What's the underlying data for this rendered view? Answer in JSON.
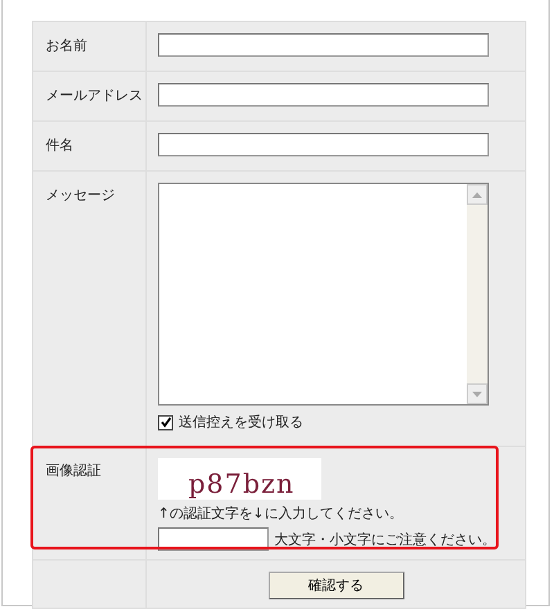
{
  "fields": [
    {
      "label": "お名前",
      "kind": "text"
    },
    {
      "label": "メールアドレス",
      "kind": "text"
    },
    {
      "label": "件名",
      "kind": "text"
    },
    {
      "label": "メッセージ",
      "kind": "textarea",
      "checkbox": {
        "label": "送信控えを受け取る",
        "checked": true
      }
    }
  ],
  "captcha": {
    "label": "画像認証",
    "image_text": "p87bzn",
    "instruction": "↑の認証文字を↓に入力してください。",
    "note": "大文字・小文字にご注意ください。",
    "highlighted": true
  },
  "submit": {
    "label": "確認する"
  }
}
